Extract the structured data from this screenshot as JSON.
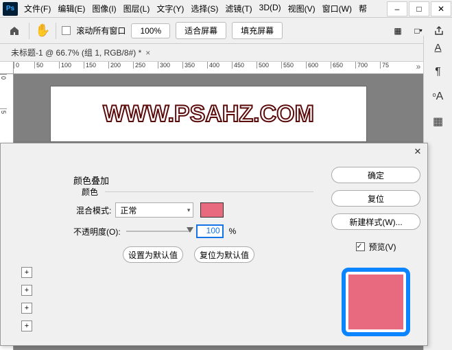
{
  "menus": [
    "文件(F)",
    "编辑(E)",
    "图像(I)",
    "图层(L)",
    "文字(Y)",
    "选择(S)",
    "滤镜(T)",
    "3D(D)",
    "视图(V)",
    "窗口(W)",
    "帮"
  ],
  "optbar": {
    "scroll_all": "滚动所有窗口",
    "zoom": "100%",
    "fit_screen": "适合屏幕",
    "fill_screen": "填充屏幕"
  },
  "tab": {
    "label": "未标题-1 @ 66.7% (组 1, RGB/8#) *",
    "close": "×"
  },
  "ruler_h": [
    "0",
    "50",
    "100",
    "150",
    "200",
    "250",
    "300",
    "350",
    "400",
    "450",
    "500",
    "550",
    "600",
    "650",
    "700",
    "75"
  ],
  "ruler_v": [
    "0",
    "5"
  ],
  "canvas": {
    "text": "WWW.PSAHZ.COM"
  },
  "dialog": {
    "section": "颜色叠加",
    "sub": "颜色",
    "blend_label": "混合模式:",
    "blend_value": "正常",
    "opacity_label": "不透明度(O):",
    "opacity_value": "100",
    "pct": "%",
    "set_default": "设置为默认值",
    "reset_default": "复位为默认值",
    "ok": "确定",
    "cancel": "复位",
    "new_style": "新建样式(W)...",
    "preview": "预览(V)",
    "swatch_color": "#e86a7e",
    "preview_border": "#0a84ff"
  }
}
